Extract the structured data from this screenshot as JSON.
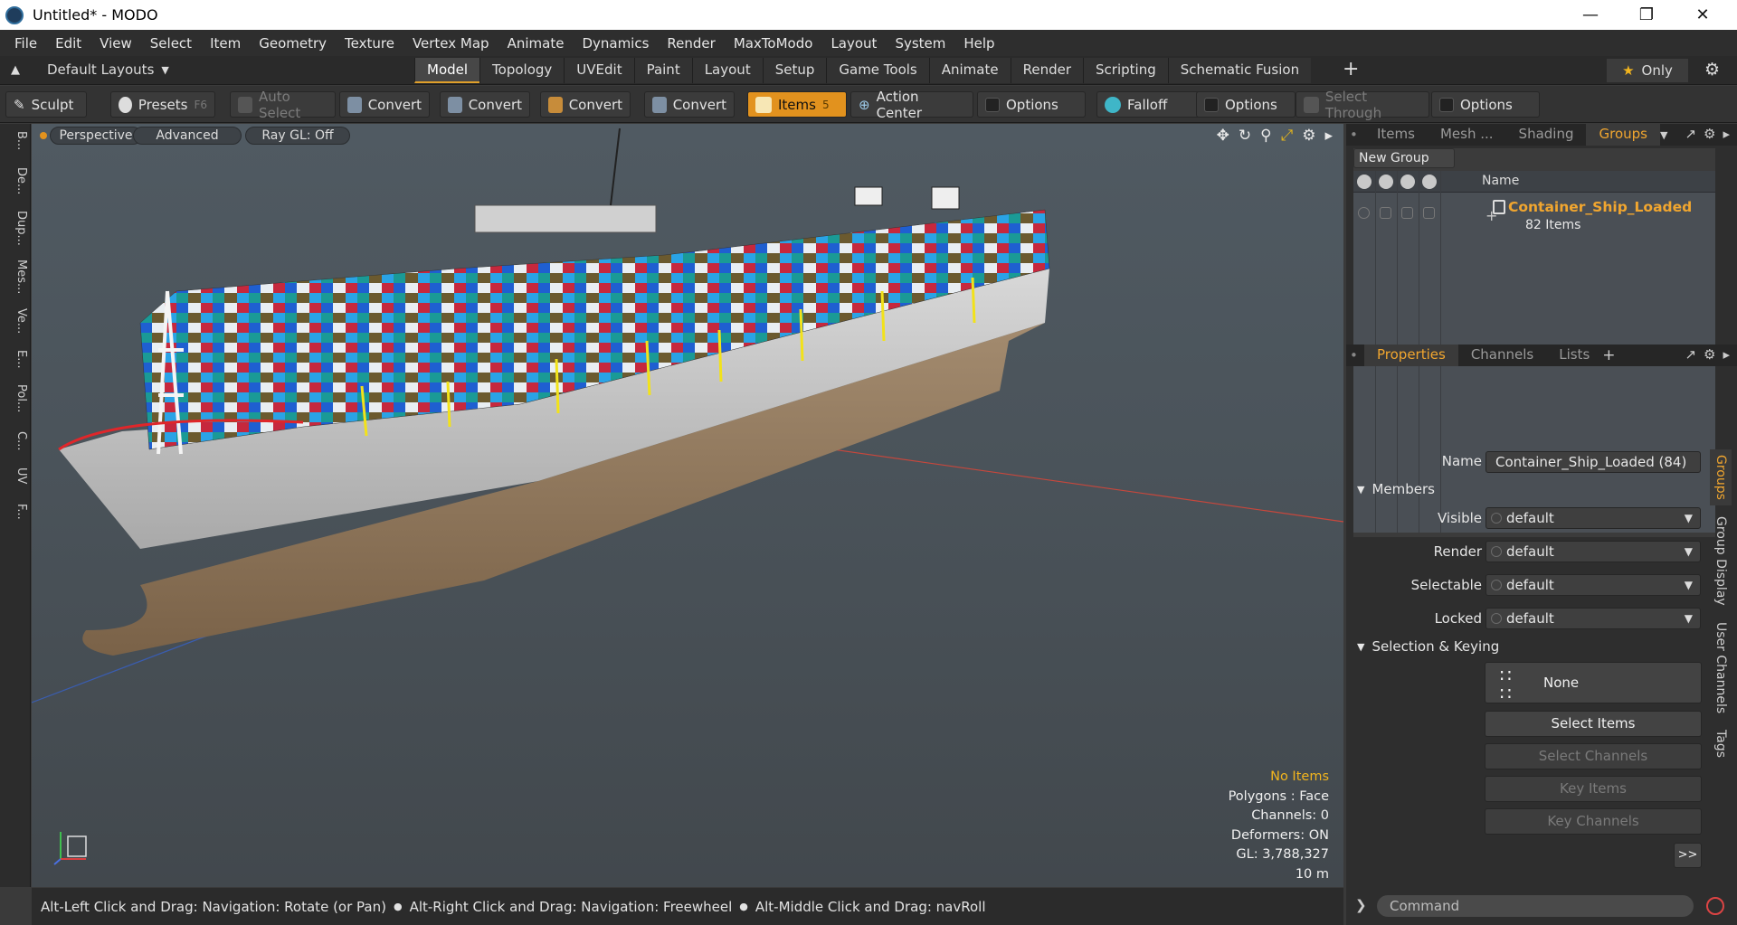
{
  "window": {
    "title": "Untitled* - MODO",
    "controls": [
      "minimize",
      "restore",
      "close"
    ]
  },
  "menu": [
    "File",
    "Edit",
    "View",
    "Select",
    "Item",
    "Geometry",
    "Texture",
    "Vertex Map",
    "Animate",
    "Dynamics",
    "Render",
    "MaxToModo",
    "Layout",
    "System",
    "Help"
  ],
  "layoutbar": {
    "layouts_label": "Default Layouts",
    "tabs": [
      "Model",
      "Topology",
      "UVEdit",
      "Paint",
      "Layout",
      "Setup",
      "Game Tools",
      "Animate",
      "Render",
      "Scripting",
      "Schematic Fusion"
    ],
    "active_tab": "Model",
    "only_label": "Only"
  },
  "toolbar": {
    "sculpt": "Sculpt",
    "presets": "Presets",
    "presets_key": "F6",
    "auto_select": "Auto Select",
    "convert1": "Convert",
    "convert2": "Convert",
    "convert3": "Convert",
    "convert4": "Convert",
    "items": "Items",
    "items_key": "5",
    "action_center": "Action Center",
    "options1": "Options",
    "falloff": "Falloff",
    "options2": "Options",
    "select_through": "Select Through",
    "options3": "Options"
  },
  "left_tabs": [
    "B...",
    "De...",
    "Dup...",
    "Mes...",
    "Ve...",
    "E...",
    "Pol...",
    "C...",
    "UV",
    "F..."
  ],
  "viewport": {
    "view_mode": "Perspective",
    "shading": "Advanced",
    "raygl": "Ray GL: Off",
    "info": {
      "selection": "No Items",
      "polygons": "Polygons : Face",
      "channels": "Channels: 0",
      "deformers": "Deformers: ON",
      "gl": "GL: 3,788,327",
      "scale": "10 m"
    }
  },
  "statusbar": {
    "hint1": "Alt-Left Click and Drag: Navigation: Rotate (or Pan)",
    "hint2": "Alt-Right Click and Drag: Navigation: Freewheel",
    "hint3": "Alt-Middle Click and Drag: navRoll"
  },
  "top_panel": {
    "tabs": [
      "Items",
      "Mesh ...",
      "Shading",
      "Groups"
    ],
    "active_tab": "Groups",
    "new_group": "New Group",
    "column_name": "Name",
    "group": {
      "name": "Container_Ship_Loaded",
      "count": "82 Items"
    }
  },
  "properties_panel": {
    "tabs": [
      "Properties",
      "Channels",
      "Lists"
    ],
    "active_tab": "Properties",
    "name_label": "Name",
    "name_value": "Container_Ship_Loaded (84)",
    "members_header": "Members",
    "visible_label": "Visible",
    "visible_value": "default",
    "render_label": "Render",
    "render_value": "default",
    "selectable_label": "Selectable",
    "selectable_value": "default",
    "locked_label": "Locked",
    "locked_value": "default",
    "selection_header": "Selection & Keying",
    "none_label": "None",
    "select_items": "Select Items",
    "select_channels": "Select Channels",
    "key_items": "Key Items",
    "key_channels": "Key Channels",
    "more": ">>",
    "side_tabs": [
      "Groups",
      "Group Display",
      "User Channels",
      "Tags"
    ]
  },
  "command": {
    "placeholder": "Command"
  },
  "colors": {
    "accent": "#e2921e",
    "highlight_text": "#f1a62f"
  }
}
